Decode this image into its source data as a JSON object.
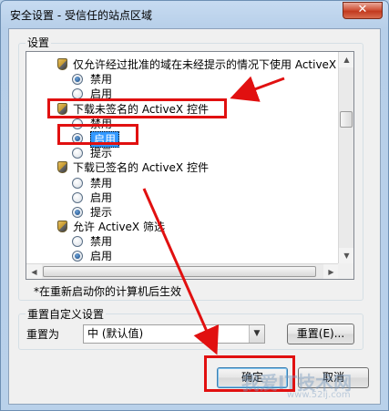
{
  "window": {
    "title": "安全设置 - 受信任的站点区域",
    "close_glyph": "✕"
  },
  "settings_group": {
    "label": "设置",
    "items": [
      {
        "type": "header",
        "label": "仅允许经过批准的域在未经提示的情况下使用 ActiveX"
      },
      {
        "type": "radio",
        "label": "禁用",
        "checked": true
      },
      {
        "type": "radio",
        "label": "启用",
        "checked": false
      },
      {
        "type": "header",
        "label": "下载未签名的 ActiveX 控件"
      },
      {
        "type": "radio",
        "label": "禁用",
        "checked": false
      },
      {
        "type": "radio",
        "label": "启用",
        "checked": true
      },
      {
        "type": "radio",
        "label": "提示",
        "checked": false
      },
      {
        "type": "header",
        "label": "下载已签名的 ActiveX 控件"
      },
      {
        "type": "radio",
        "label": "禁用",
        "checked": false
      },
      {
        "type": "radio",
        "label": "启用",
        "checked": false
      },
      {
        "type": "radio",
        "label": "提示",
        "checked": true
      },
      {
        "type": "header",
        "label": "允许 ActiveX 筛选"
      },
      {
        "type": "radio",
        "label": "禁用",
        "checked": false
      },
      {
        "type": "radio",
        "label": "启用",
        "checked": true
      }
    ],
    "note": "*在重新启动你的计算机后生效"
  },
  "reset_group": {
    "label": "重置自定义设置",
    "reset_to_label": "重置为",
    "selected_level": "中 (默认值)",
    "reset_button": "重置(E)..."
  },
  "buttons": {
    "ok": "确定",
    "cancel": "取消"
  },
  "watermark": "我爱IT技术网",
  "watermark_url": "www.52ij.com",
  "colors": {
    "annotation": "#e11010",
    "selection": "#3399ff"
  }
}
